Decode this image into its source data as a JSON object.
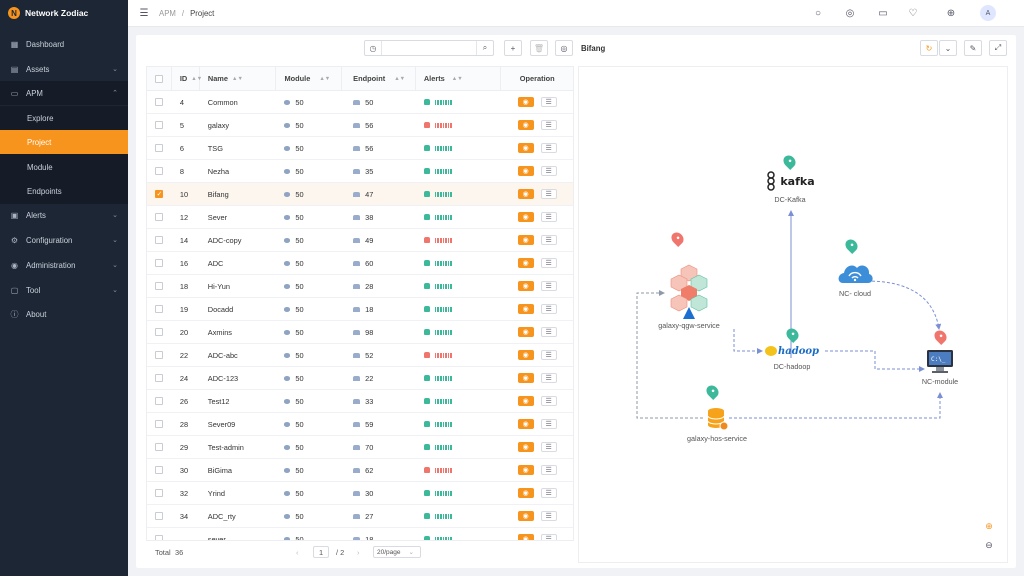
{
  "app": {
    "name": "Network Zodiac",
    "logo_letter": "N"
  },
  "sidebar": {
    "items": [
      {
        "label": "Dashboard",
        "icon": "dashboard-icon"
      },
      {
        "label": "Assets",
        "icon": "assets-icon"
      },
      {
        "label": "APM",
        "icon": "apm-icon"
      },
      {
        "label": "Explore"
      },
      {
        "label": "Project"
      },
      {
        "label": "Module"
      },
      {
        "label": "Endpoints"
      },
      {
        "label": "Alerts",
        "icon": "alert-icon"
      },
      {
        "label": "Configuration",
        "icon": "gear-icon"
      },
      {
        "label": "Administration",
        "icon": "user-icon"
      },
      {
        "label": "Tool",
        "icon": "tool-icon"
      },
      {
        "label": "About",
        "icon": "info-icon"
      }
    ],
    "active": "Project",
    "accent": "#f7941d"
  },
  "header": {
    "breadcrumb": [
      "APM",
      "Project"
    ],
    "separator": "/",
    "avatar": "A"
  },
  "toolbar": {
    "search_placeholder": "",
    "project_title": "Bifang"
  },
  "table": {
    "columns": [
      "ID",
      "Name",
      "Module",
      "Endpoint",
      "Alerts",
      "Operation"
    ],
    "rows": [
      {
        "id": "4",
        "name": "Common",
        "module": "50",
        "endpoint": "50",
        "alert": "green",
        "selected": false
      },
      {
        "id": "5",
        "name": "galaxy",
        "module": "50",
        "endpoint": "56",
        "alert": "red",
        "selected": false
      },
      {
        "id": "6",
        "name": "TSG",
        "module": "50",
        "endpoint": "56",
        "alert": "green",
        "selected": false
      },
      {
        "id": "8",
        "name": "Nezha",
        "module": "50",
        "endpoint": "35",
        "alert": "green",
        "selected": false
      },
      {
        "id": "10",
        "name": "Bifang",
        "module": "50",
        "endpoint": "47",
        "alert": "green",
        "selected": true
      },
      {
        "id": "12",
        "name": "Sever",
        "module": "50",
        "endpoint": "38",
        "alert": "green",
        "selected": false
      },
      {
        "id": "14",
        "name": "ADC-copy",
        "module": "50",
        "endpoint": "49",
        "alert": "red",
        "selected": false
      },
      {
        "id": "16",
        "name": "ADC",
        "module": "50",
        "endpoint": "60",
        "alert": "green",
        "selected": false
      },
      {
        "id": "18",
        "name": "Hi-Yun",
        "module": "50",
        "endpoint": "28",
        "alert": "green",
        "selected": false
      },
      {
        "id": "19",
        "name": "Docadd",
        "module": "50",
        "endpoint": "18",
        "alert": "green",
        "selected": false
      },
      {
        "id": "20",
        "name": "Axmins",
        "module": "50",
        "endpoint": "98",
        "alert": "green",
        "selected": false
      },
      {
        "id": "22",
        "name": "ADC-abc",
        "module": "50",
        "endpoint": "52",
        "alert": "red",
        "selected": false
      },
      {
        "id": "24",
        "name": "ADC-123",
        "module": "50",
        "endpoint": "22",
        "alert": "green",
        "selected": false
      },
      {
        "id": "26",
        "name": "Test12",
        "module": "50",
        "endpoint": "33",
        "alert": "green",
        "selected": false
      },
      {
        "id": "28",
        "name": "Sever09",
        "module": "50",
        "endpoint": "59",
        "alert": "green",
        "selected": false
      },
      {
        "id": "29",
        "name": "Test-admin",
        "module": "50",
        "endpoint": "70",
        "alert": "green",
        "selected": false
      },
      {
        "id": "30",
        "name": "BiGima",
        "module": "50",
        "endpoint": "62",
        "alert": "red",
        "selected": false
      },
      {
        "id": "32",
        "name": "Yrind",
        "module": "50",
        "endpoint": "30",
        "alert": "green",
        "selected": false
      },
      {
        "id": "34",
        "name": "ADC_rty",
        "module": "50",
        "endpoint": "27",
        "alert": "green",
        "selected": false
      },
      {
        "id": "",
        "name": "sever",
        "module": "50",
        "endpoint": "18",
        "alert": "green",
        "selected": false
      }
    ]
  },
  "pagination": {
    "total_label": "Total",
    "total": "36",
    "current": "1",
    "of": "/ 2",
    "page_size": "20/page",
    "prev": "‹",
    "next": "›"
  },
  "graph": {
    "nodes": [
      {
        "id": "dc-kafka",
        "label": "DC-Kafka",
        "logo": "kafka",
        "status": "green"
      },
      {
        "id": "galaxy-qgw",
        "label": "galaxy-qgw-service",
        "status": "red"
      },
      {
        "id": "nc-cloud",
        "label": "NC- cloud",
        "status": "green"
      },
      {
        "id": "dc-hadoop",
        "label": "DC-hadoop",
        "logo": "hadoop",
        "status": "green"
      },
      {
        "id": "nc-module",
        "label": "NC-module",
        "status": "red"
      },
      {
        "id": "galaxy-hos",
        "label": "galaxy-hos-service",
        "status": "green"
      }
    ],
    "colors": {
      "green": "#3cb99a",
      "red": "#f0756c",
      "edge": "#7b8fd6"
    }
  },
  "colors": {
    "green": "#3cb99a",
    "red": "#f0756c",
    "accent": "#f7941d"
  }
}
